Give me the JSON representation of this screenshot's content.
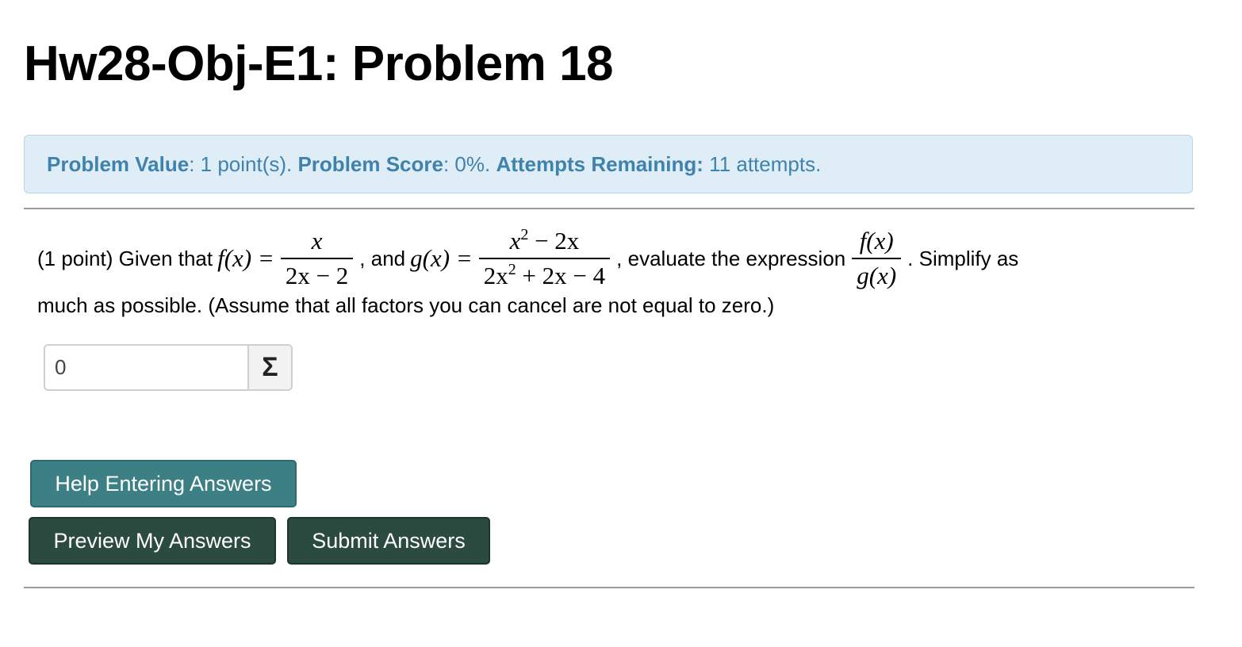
{
  "page_title": "Hw28-Obj-E1: Problem 18",
  "status": {
    "value_label": "Problem Value",
    "value_text": ": 1 point(s). ",
    "score_label": "Problem Score",
    "score_text": ": 0%. ",
    "attempts_label": "Attempts Remaining:",
    "attempts_text": " 11 attempts."
  },
  "problem": {
    "prefix": "(1 point) Given that",
    "f_lhs": "f(x) =",
    "f_num": "x",
    "f_den": "2x − 2",
    "and_text": ", and",
    "g_lhs": "g(x) =",
    "g_num_base": "x",
    "g_num_exp": "2",
    "g_num_rest": " − 2x",
    "g_den_pre": "2x",
    "g_den_exp": "2",
    "g_den_rest": " + 2x − 4",
    "eval_text": ", evaluate the expression",
    "expr_num": "f(x)",
    "expr_den": "g(x)",
    "suffix": ". Simplify as",
    "line2": "much as possible. (Assume that all factors you can cancel are not equal to zero.)"
  },
  "answer": {
    "value": "0",
    "tool_icon": "sigma-icon",
    "tool_glyph": "Σ"
  },
  "buttons": {
    "help": "Help Entering Answers",
    "preview": "Preview My Answers",
    "submit": "Submit Answers"
  },
  "colors": {
    "info_bg": "#dfedf7",
    "info_text": "#3f82ad",
    "help_button": "#3c8085",
    "action_button": "#2b4a40"
  }
}
